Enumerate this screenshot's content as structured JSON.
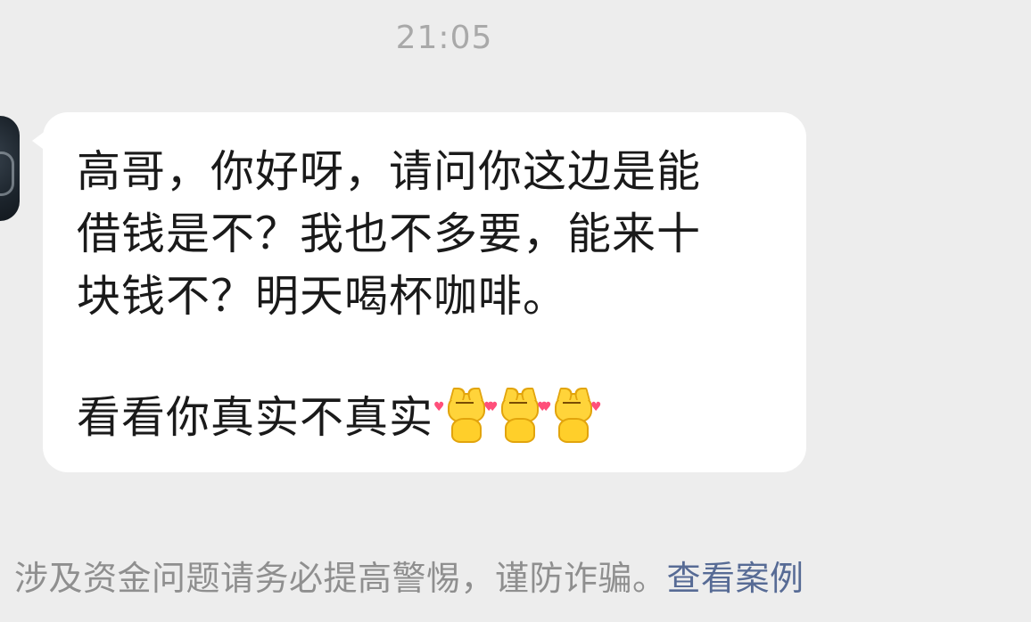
{
  "timestamp": "21:05",
  "message": {
    "lines": [
      "高哥，你好呀，请问你这边是能",
      "借钱是不？我也不多要，能来十",
      "块钱不？明天喝杯咖啡。"
    ],
    "last_line": "看看你真实不真实",
    "emojis": [
      "cat-heart-emoji",
      "cat-heart-emoji",
      "cat-heart-emoji"
    ]
  },
  "warning": {
    "text": "涉及资金问题请务必提高警惕，谨防诈骗。",
    "link_label": "查看案例"
  },
  "colors": {
    "background": "#ededed",
    "bubble": "#ffffff",
    "timestamp": "#a9a9a9",
    "warning_text": "#8f8f8f",
    "link": "#576b95"
  }
}
